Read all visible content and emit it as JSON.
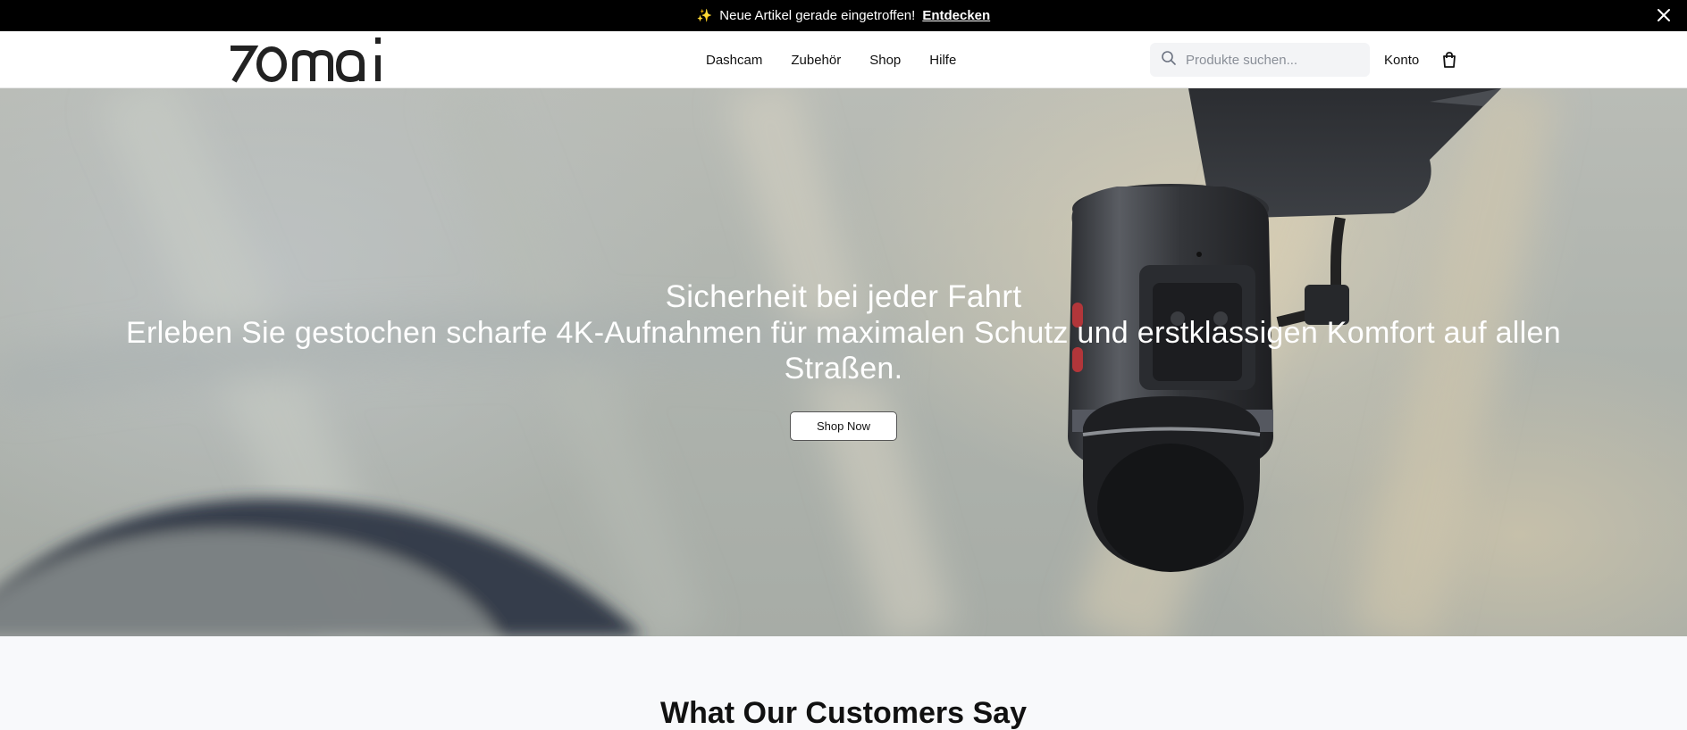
{
  "announcement": {
    "sparkle": "✨",
    "message": "Neue Artikel gerade eingetroffen!",
    "link_label": "Entdecken"
  },
  "header": {
    "logo_text": "70mai",
    "nav": [
      {
        "label": "Dashcam"
      },
      {
        "label": "Zubehör"
      },
      {
        "label": "Shop"
      },
      {
        "label": "Hilfe"
      }
    ],
    "search": {
      "placeholder": "Produkte suchen...",
      "value": ""
    },
    "account_label": "Konto"
  },
  "hero": {
    "title": "Sicherheit bei jeder Fahrt",
    "subtitle": "Erleben Sie gestochen scharfe 4K-Aufnahmen für maximalen Schutz und erstklassigen Komfort auf allen Straßen.",
    "button_label": "Shop Now"
  },
  "testimonials": {
    "heading": "What Our Customers Say"
  },
  "icons": {
    "close": "close-icon",
    "search": "search-icon",
    "cart": "shopping-bag-icon"
  },
  "colors": {
    "announcement_bg": "#000000",
    "header_bg": "#ffffff",
    "section_bg": "#f8f9fb",
    "button_bg": "#ffffff"
  }
}
